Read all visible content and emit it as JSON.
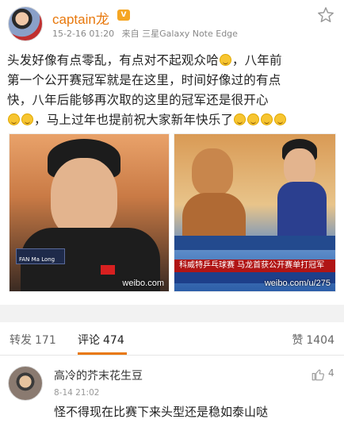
{
  "post": {
    "username": "captain龙",
    "badge": "V",
    "date": "15-2-16 01:20",
    "source": "来自 三星Galaxy Note Edge",
    "text_lines": [
      "头发好像有点零乱，有点对不起观众哈",
      "，八年前",
      "第一个公开赛冠军就是在这里，时间好像过的有点",
      "快，八年后能够再次取的这里的冠军还是很开心",
      "，马上过年也提前祝大家新年快乐了"
    ],
    "photo_left": {
      "scoreboard_text": "FAN  Ma Long",
      "watermark": "weibo.com"
    },
    "photo_right": {
      "caption": "科威特乒乓球赛  马龙首获公开赛单打冠军",
      "watermark": "weibo.com/u/275"
    }
  },
  "tabs": {
    "forward_label": "转发",
    "forward_count": "171",
    "comment_label": "评论",
    "comment_count": "474",
    "like_label": "赞",
    "like_count": "1404"
  },
  "comment": {
    "name": "高冷的芥末花生豆",
    "time": "8-14 21:02",
    "text": "怪不得现在比赛下来头型还是稳如泰山哒",
    "like_count": "4"
  },
  "colors": {
    "accent": "#e8780c",
    "vip": "#f5a623"
  },
  "icons": [
    "star-icon",
    "thumbs-up-icon",
    "emoji-icon"
  ]
}
